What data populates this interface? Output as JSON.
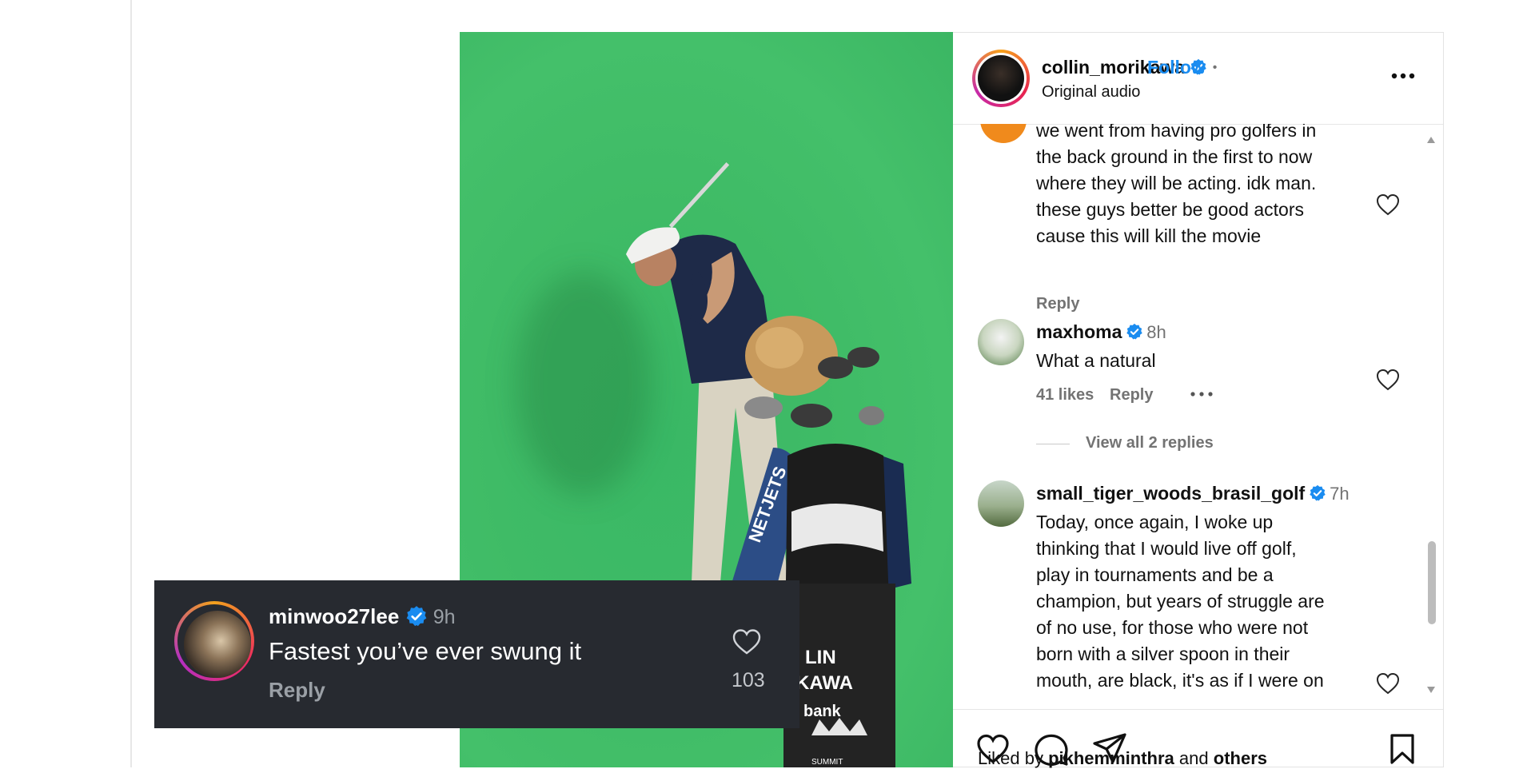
{
  "post": {
    "username": "collin_morikawa",
    "follow_label": "Follow",
    "separator": "•",
    "audio": "Original audio"
  },
  "comments": [
    {
      "text_lines": [
        "we went from having pro golfers in",
        "the back ground in the first to now",
        "where they will be acting. idk man.",
        "these guys better be good actors",
        "cause this will kill the movie"
      ],
      "reply_label": "Reply"
    },
    {
      "username": "maxhoma",
      "time": "8h",
      "text": "What a natural",
      "likes": "41 likes",
      "reply_label": "Reply",
      "view_replies": "View all 2 replies"
    },
    {
      "username": "small_tiger_woods_brasil_golf",
      "time": "7h",
      "text_lines": [
        "Today, once again, I woke up",
        "thinking that I would live off golf,",
        "play in tournaments and be a",
        "champion, but years of struggle are",
        "of no use, for those who were not",
        "born with a silver spoon in their",
        "mouth, are black, it's as if I were on"
      ]
    }
  ],
  "liked_by": {
    "prefix": "Liked by",
    "user": "pikhemminthra",
    "and": "and",
    "others": "others"
  },
  "overlay_comment": {
    "username": "minwoo27lee",
    "time": "9h",
    "text": "Fastest you’ve ever swung it",
    "reply_label": "Reply",
    "like_count": "103"
  },
  "bag_text": {
    "towel": "NETJETS",
    "bag_line1": "LIN",
    "bag_line2": "KAWA",
    "bag_line3": "bank",
    "bag_line4": "SUMMIT"
  },
  "colors": {
    "accent": "#1a8cf0",
    "green_screen": "#40bc68",
    "overlay_bg": "#272a30"
  }
}
